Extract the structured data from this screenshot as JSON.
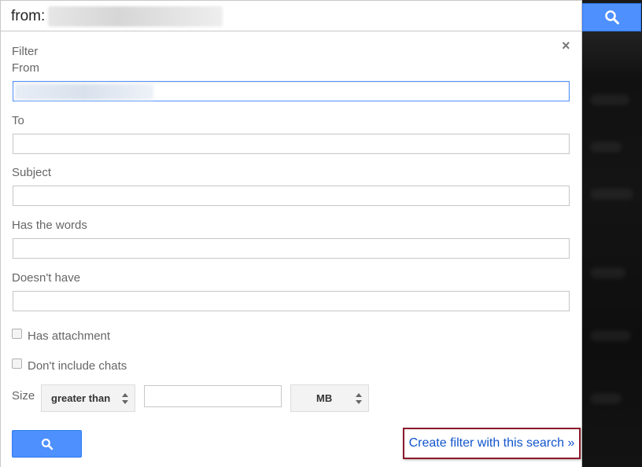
{
  "search": {
    "query_label": "from:"
  },
  "filter": {
    "title": "Filter",
    "close_label": "×",
    "fields": {
      "from_label": "From",
      "to_label": "To",
      "subject_label": "Subject",
      "has_words_label": "Has the words",
      "doesnt_have_label": "Doesn't have"
    },
    "checkboxes": {
      "has_attachment": "Has attachment",
      "dont_include_chats": "Don't include chats"
    },
    "size": {
      "label": "Size",
      "comparator": "greater than",
      "unit": "MB"
    },
    "create_filter_link": "Create filter with this search »"
  },
  "icons": {
    "search": "search-icon",
    "close": "close-icon",
    "select_arrows": "updown-arrows-icon"
  },
  "colors": {
    "primary_blue": "#4d90fe",
    "link_blue": "#1155cc",
    "highlight_border": "#8b1a2b"
  }
}
